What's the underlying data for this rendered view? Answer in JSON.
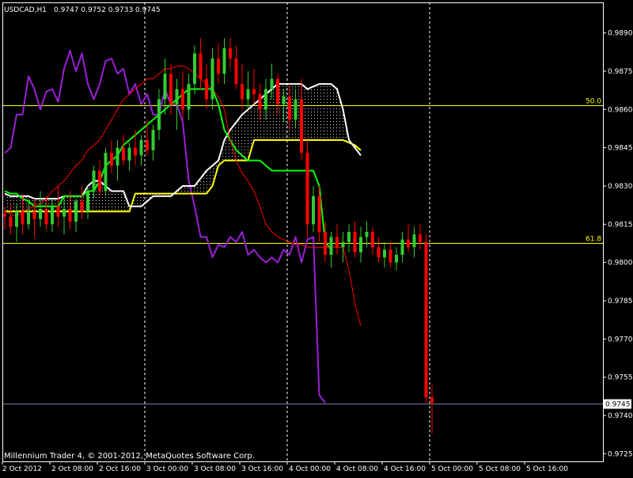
{
  "header": {
    "symbol": "USDCAD,H1",
    "ohlc": "0.9747 0.9752 0.9733 0.9745"
  },
  "footer": {
    "copyright": "Millennium Trader 4, © 2001-2012, MetaQuotes Software Corp."
  },
  "colors": {
    "background": "#000000",
    "axis": "#ffffff",
    "bull": "#32cd32",
    "bear": "#ff0000",
    "tenkan": "#ff0000",
    "kijun": "#00ff00",
    "span_a": "#ffffff",
    "span_b": "#ffff00",
    "chikou": "#9a1fd6",
    "fib": "#ffff00",
    "bid_line": "#7f7f9f",
    "cloud_hatch": "#ffffff"
  },
  "chart_data": {
    "type": "candlestick",
    "ylim": [
      0.9722,
      0.9902
    ],
    "y_ticks": [
      "0.9890",
      "0.9875",
      "0.9860",
      "0.9845",
      "0.9830",
      "0.9815",
      "0.9800",
      "0.9785",
      "0.9770",
      "0.9755",
      "0.9740",
      "0.9725"
    ],
    "x_ticks": [
      "2 Oct 2012",
      "2 Oct 08:00",
      "2 Oct 16:00",
      "3 Oct 00:00",
      "3 Oct 08:00",
      "3 Oct 16:00",
      "4 Oct 00:00",
      "4 Oct 08:00",
      "4 Oct 16:00",
      "5 Oct 00:00",
      "5 Oct 08:00",
      "5 Oct 16:00"
    ],
    "x_tick_index": [
      0,
      8,
      16,
      24,
      32,
      40,
      48,
      56,
      64,
      72,
      80,
      88
    ],
    "candles_per_grid": 8,
    "fib_levels": [
      {
        "label": "50.0",
        "price": 0.98615
      },
      {
        "label": "61.8",
        "price": 0.98075
      }
    ],
    "current_price": {
      "label": "0.9745",
      "price": 0.97445
    },
    "candles": [
      [
        0.9819,
        0.9822,
        0.9813,
        0.9818
      ],
      [
        0.9818,
        0.9823,
        0.9811,
        0.9814
      ],
      [
        0.9814,
        0.9823,
        0.9808,
        0.982
      ],
      [
        0.982,
        0.9827,
        0.9811,
        0.9815
      ],
      [
        0.9815,
        0.9825,
        0.9813,
        0.982
      ],
      [
        0.982,
        0.9825,
        0.981,
        0.9817
      ],
      [
        0.9817,
        0.9828,
        0.9814,
        0.9821
      ],
      [
        0.9821,
        0.9826,
        0.9813,
        0.9815
      ],
      [
        0.9815,
        0.9825,
        0.9812,
        0.9822
      ],
      [
        0.9822,
        0.983,
        0.9814,
        0.9818
      ],
      [
        0.9818,
        0.9826,
        0.9811,
        0.9821
      ],
      [
        0.9821,
        0.9828,
        0.9813,
        0.9816
      ],
      [
        0.9816,
        0.9825,
        0.9812,
        0.9824
      ],
      [
        0.9824,
        0.983,
        0.9817,
        0.982
      ],
      [
        0.982,
        0.983,
        0.9817,
        0.9828
      ],
      [
        0.9828,
        0.9838,
        0.9825,
        0.9836
      ],
      [
        0.9836,
        0.984,
        0.9826,
        0.9828
      ],
      [
        0.9828,
        0.9845,
        0.9826,
        0.9843
      ],
      [
        0.9843,
        0.9848,
        0.9835,
        0.9838
      ],
      [
        0.9838,
        0.9848,
        0.9832,
        0.9845
      ],
      [
        0.9845,
        0.985,
        0.9838,
        0.984
      ],
      [
        0.984,
        0.9847,
        0.9836,
        0.9845
      ],
      [
        0.9845,
        0.9852,
        0.9838,
        0.9842
      ],
      [
        0.9842,
        0.985,
        0.9838,
        0.9848
      ],
      [
        0.9848,
        0.9856,
        0.9842,
        0.9844
      ],
      [
        0.9844,
        0.9854,
        0.984,
        0.9852
      ],
      [
        0.9852,
        0.9868,
        0.9848,
        0.9864
      ],
      [
        0.9864,
        0.988,
        0.9858,
        0.9874
      ],
      [
        0.9874,
        0.9878,
        0.9858,
        0.9862
      ],
      [
        0.9862,
        0.9872,
        0.9852,
        0.9868
      ],
      [
        0.9868,
        0.9875,
        0.9856,
        0.986
      ],
      [
        0.986,
        0.9874,
        0.9856,
        0.987
      ],
      [
        0.987,
        0.9885,
        0.9866,
        0.9882
      ],
      [
        0.9882,
        0.9888,
        0.9868,
        0.9872
      ],
      [
        0.9872,
        0.9878,
        0.986,
        0.9864
      ],
      [
        0.9864,
        0.9884,
        0.986,
        0.988
      ],
      [
        0.988,
        0.9886,
        0.987,
        0.9874
      ],
      [
        0.9874,
        0.9888,
        0.987,
        0.9884
      ],
      [
        0.9884,
        0.9888,
        0.9876,
        0.988
      ],
      [
        0.988,
        0.9885,
        0.9868,
        0.987
      ],
      [
        0.987,
        0.9878,
        0.986,
        0.9864
      ],
      [
        0.9864,
        0.9875,
        0.986,
        0.9868
      ],
      [
        0.9868,
        0.9876,
        0.9862,
        0.9866
      ],
      [
        0.9866,
        0.987,
        0.9856,
        0.986
      ],
      [
        0.986,
        0.9872,
        0.9856,
        0.9868
      ],
      [
        0.9868,
        0.9878,
        0.9864,
        0.9872
      ],
      [
        0.9872,
        0.9874,
        0.9858,
        0.9862
      ],
      [
        0.9862,
        0.9868,
        0.9855,
        0.9865
      ],
      [
        0.9865,
        0.987,
        0.9852,
        0.9856
      ],
      [
        0.9856,
        0.9868,
        0.9853,
        0.9864
      ],
      [
        0.9864,
        0.9872,
        0.984,
        0.9843
      ],
      [
        0.9843,
        0.9848,
        0.981,
        0.9815
      ],
      [
        0.9815,
        0.983,
        0.9812,
        0.9826
      ],
      [
        0.9826,
        0.983,
        0.9808,
        0.9812
      ],
      [
        0.9812,
        0.9816,
        0.98,
        0.9803
      ],
      [
        0.9803,
        0.9812,
        0.9798,
        0.981
      ],
      [
        0.981,
        0.9815,
        0.9803,
        0.9806
      ],
      [
        0.9806,
        0.9812,
        0.98,
        0.9808
      ],
      [
        0.9808,
        0.9815,
        0.9804,
        0.9812
      ],
      [
        0.9812,
        0.9816,
        0.9802,
        0.9804
      ],
      [
        0.9804,
        0.9814,
        0.98,
        0.981
      ],
      [
        0.981,
        0.9816,
        0.9806,
        0.9812
      ],
      [
        0.9812,
        0.9814,
        0.9803,
        0.9806
      ],
      [
        0.9806,
        0.981,
        0.98,
        0.9802
      ],
      [
        0.9802,
        0.9808,
        0.9798,
        0.9805
      ],
      [
        0.9805,
        0.9808,
        0.9798,
        0.98
      ],
      [
        0.98,
        0.9806,
        0.9797,
        0.9803
      ],
      [
        0.9803,
        0.9812,
        0.98,
        0.9809
      ],
      [
        0.9809,
        0.9815,
        0.9804,
        0.9806
      ],
      [
        0.9806,
        0.9814,
        0.9802,
        0.9811
      ],
      [
        0.9811,
        0.9815,
        0.9805,
        0.9808
      ],
      [
        0.9808,
        0.9811,
        0.9745,
        0.9747
      ],
      [
        0.9747,
        0.9752,
        0.9733,
        0.9745
      ]
    ],
    "tenkan": [
      0.982,
      0.9819,
      0.9818,
      0.982,
      0.9821,
      0.9822,
      0.9823,
      0.9825,
      0.9828,
      0.983,
      0.9832,
      0.9835,
      0.9838,
      0.984,
      0.9844,
      0.9846,
      0.9848,
      0.9852,
      0.9856,
      0.986,
      0.9864,
      0.9866,
      0.9868,
      0.987,
      0.9872,
      0.9872,
      0.9874,
      0.9876,
      0.9876,
      0.9877,
      0.9877,
      0.9876,
      0.9874,
      0.9872,
      0.987,
      0.9868,
      0.9865,
      0.986,
      0.9848,
      0.984,
      0.9835,
      0.9832,
      0.9828,
      0.9822,
      0.9815,
      0.9812,
      0.981,
      0.9809,
      0.9808,
      0.9807,
      0.9807,
      0.9806,
      0.9806,
      0.9806,
      0.9806,
      0.9806,
      0.9806,
      0.9806,
      0.9797,
      0.9784,
      0.9775
    ],
    "kijun": [
      0.9828,
      0.9827,
      0.9827,
      0.9825,
      0.9824,
      0.9822,
      0.9822,
      0.9822,
      0.9822,
      0.9822,
      0.9826,
      0.9826,
      0.9826,
      0.9826,
      0.9828,
      0.9828,
      0.9832,
      0.9838,
      0.984,
      0.9842,
      0.9846,
      0.9848,
      0.985,
      0.9852,
      0.9854,
      0.9856,
      0.9858,
      0.986,
      0.9862,
      0.9864,
      0.9866,
      0.9868,
      0.9868,
      0.9868,
      0.9868,
      0.9868,
      0.9862,
      0.9852,
      0.9848,
      0.9844,
      0.9842,
      0.984,
      0.984,
      0.984,
      0.9838,
      0.9836,
      0.9836,
      0.9836,
      0.9836,
      0.9836,
      0.9836,
      0.9836,
      0.9836,
      0.983,
      0.9808,
      0.9805
    ],
    "span_a": [
      0.9827,
      0.9826,
      0.9826,
      0.9826,
      0.9826,
      0.9825,
      0.9825,
      0.9825,
      0.9825,
      0.9825,
      0.9826,
      0.9826,
      0.9826,
      0.9826,
      0.983,
      0.9832,
      0.9832,
      0.983,
      0.9828,
      0.9828,
      0.9828,
      0.9822,
      0.9822,
      0.9822,
      0.9824,
      0.9826,
      0.9826,
      0.9826,
      0.9826,
      0.9828,
      0.983,
      0.983,
      0.983,
      0.9833,
      0.9836,
      0.9838,
      0.984,
      0.9848,
      0.9852,
      0.9855,
      0.9858,
      0.986,
      0.9862,
      0.9864,
      0.9866,
      0.9868,
      0.987,
      0.987,
      0.987,
      0.987,
      0.987,
      0.9868,
      0.9869,
      0.987,
      0.987,
      0.987,
      0.9868,
      0.986,
      0.9848,
      0.9845,
      0.9842
    ],
    "span_b": [
      0.982,
      0.982,
      0.982,
      0.982,
      0.982,
      0.982,
      0.982,
      0.982,
      0.982,
      0.982,
      0.982,
      0.982,
      0.982,
      0.982,
      0.982,
      0.982,
      0.982,
      0.982,
      0.982,
      0.982,
      0.982,
      0.982,
      0.9827,
      0.9827,
      0.9827,
      0.9827,
      0.9827,
      0.9827,
      0.9827,
      0.9827,
      0.9827,
      0.9827,
      0.9827,
      0.9827,
      0.9827,
      0.983,
      0.9838,
      0.984,
      0.984,
      0.984,
      0.984,
      0.984,
      0.9848,
      0.9848,
      0.9848,
      0.9848,
      0.9848,
      0.9848,
      0.9848,
      0.9848,
      0.9848,
      0.9848,
      0.9848,
      0.9848,
      0.9848,
      0.9848,
      0.9848,
      0.9848,
      0.9847,
      0.9846,
      0.9844
    ],
    "chikou": [
      0.9843,
      0.9845,
      0.9858,
      0.9858,
      0.9873,
      0.9868,
      0.986,
      0.9867,
      0.9868,
      0.9863,
      0.9876,
      0.9883,
      0.9875,
      0.9882,
      0.987,
      0.9864,
      0.987,
      0.9879,
      0.988,
      0.9874,
      0.9876,
      0.9866,
      0.987,
      0.9862,
      0.9866,
      0.9858,
      0.9858,
      0.9868,
      0.9862,
      0.9862,
      0.9855,
      0.9832,
      0.9822,
      0.981,
      0.981,
      0.9802,
      0.9807,
      0.9806,
      0.981,
      0.9808,
      0.9812,
      0.9803,
      0.9805,
      0.9802,
      0.98,
      0.9802,
      0.98,
      0.9805,
      0.9803,
      0.981,
      0.98,
      0.9809,
      0.981,
      0.9748,
      0.9745
    ]
  }
}
